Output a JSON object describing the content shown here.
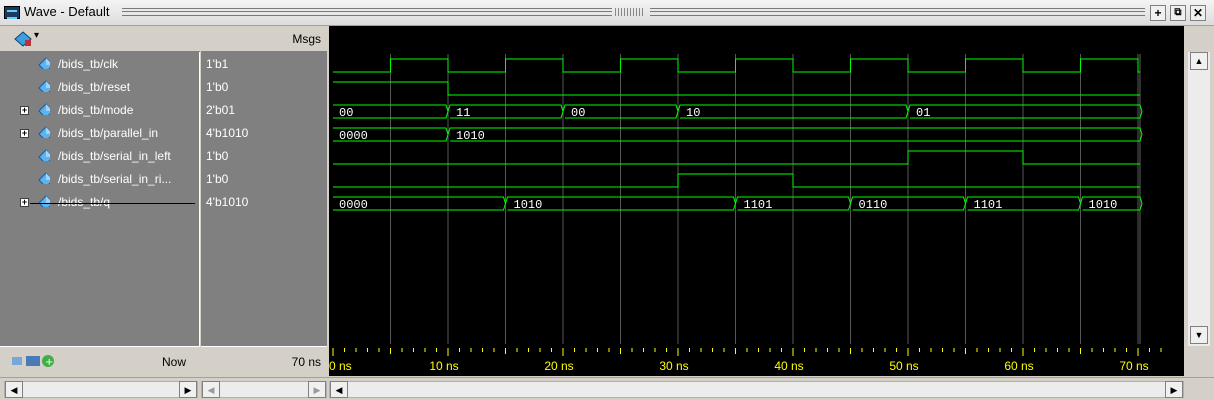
{
  "window": {
    "title": "Wave - Default"
  },
  "colors": {
    "wave": "#00ff00",
    "cursor_grid": "#a0a0a0",
    "timeline_text": "#ffff00"
  },
  "header": {
    "msgs_label": "Msgs",
    "toolbar_icon": "wave-tool-icon"
  },
  "signals": [
    {
      "name": "/bids_tb/clk",
      "value": "1'b1",
      "expandable": false,
      "kind": "bit"
    },
    {
      "name": "/bids_tb/reset",
      "value": "1'b0",
      "expandable": false,
      "kind": "bit"
    },
    {
      "name": "/bids_tb/mode",
      "value": "2'b01",
      "expandable": true,
      "kind": "bus"
    },
    {
      "name": "/bids_tb/parallel_in",
      "value": "4'b1010",
      "expandable": true,
      "kind": "bus"
    },
    {
      "name": "/bids_tb/serial_in_left",
      "value": "1'b0",
      "expandable": false,
      "kind": "bit"
    },
    {
      "name": "/bids_tb/serial_in_ri...",
      "value": "1'b0",
      "expandable": false,
      "kind": "bit"
    },
    {
      "name": "/bids_tb/q",
      "value": "4'b1010",
      "expandable": true,
      "kind": "bus"
    }
  ],
  "waves": {
    "time_range": [
      0,
      72.5
    ],
    "clk": {
      "initial": 0,
      "transitions": [
        5,
        10,
        15,
        20,
        25,
        30,
        35,
        40,
        45,
        50,
        55,
        60,
        65,
        70
      ]
    },
    "reset": {
      "initial": 1,
      "transitions": [
        10
      ]
    },
    "mode": [
      {
        "t": 0,
        "label": "00"
      },
      {
        "t": 10,
        "label": "11"
      },
      {
        "t": 20,
        "label": "00"
      },
      {
        "t": 30,
        "label": "10"
      },
      {
        "t": 50,
        "label": "01"
      }
    ],
    "parallel_in": [
      {
        "t": 0,
        "label": "0000"
      },
      {
        "t": 10,
        "label": "1010"
      }
    ],
    "serial_in_left": {
      "initial": 0,
      "transitions": [
        50,
        60
      ]
    },
    "serial_in_right": {
      "initial": 0,
      "transitions": [
        30,
        40
      ]
    },
    "q": [
      {
        "t": 0,
        "label": "0000"
      },
      {
        "t": 15,
        "label": "1010"
      },
      {
        "t": 35,
        "label": "1101"
      },
      {
        "t": 45,
        "label": "0110"
      },
      {
        "t": 55,
        "label": "1101"
      },
      {
        "t": 65,
        "label": "1010"
      }
    ]
  },
  "timeline": {
    "now_label": "Now",
    "now_value": "70 ns",
    "ticks": [
      {
        "t": 0,
        "label": "0 ns"
      },
      {
        "t": 10,
        "label": "10 ns"
      },
      {
        "t": 20,
        "label": "20 ns"
      },
      {
        "t": 30,
        "label": "30 ns"
      },
      {
        "t": 40,
        "label": "40 ns"
      },
      {
        "t": 50,
        "label": "50 ns"
      },
      {
        "t": 60,
        "label": "60 ns"
      },
      {
        "t": 70,
        "label": "70 ns"
      }
    ]
  }
}
